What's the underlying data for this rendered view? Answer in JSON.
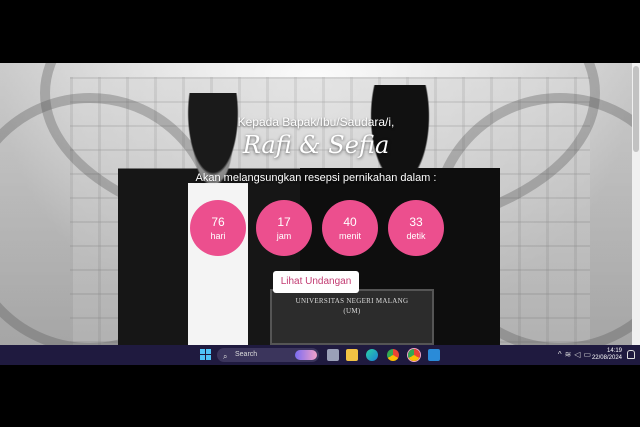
{
  "invitation": {
    "greeting": "Kepada Bapak/Ibu/Saudara/i,",
    "names": "Rafi & Sefia",
    "announcement": "Akan melangsungkan resepsi pernikahan dalam :",
    "countdown": [
      {
        "value": "76",
        "unit": "hari"
      },
      {
        "value": "17",
        "unit": "jam"
      },
      {
        "value": "40",
        "unit": "menit"
      },
      {
        "value": "33",
        "unit": "detik"
      }
    ],
    "button_label": "Lihat Undangan",
    "accent_color": "#ec4f8e",
    "diploma_text": "UNIVERSITAS NEGERI MALANG",
    "diploma_sub": "(UM)"
  },
  "taskbar": {
    "search_placeholder": "Search",
    "icons": [
      "windows-start-icon",
      "search-icon",
      "task-view-icon",
      "file-explorer-icon",
      "edge-icon",
      "chrome-icon",
      "chrome-profile-icon",
      "vscode-icon"
    ],
    "tray_icons": [
      "chevron-up-icon",
      "wifi-icon",
      "volume-icon",
      "battery-icon"
    ],
    "time": "14:19",
    "date": "22/08/2024"
  }
}
